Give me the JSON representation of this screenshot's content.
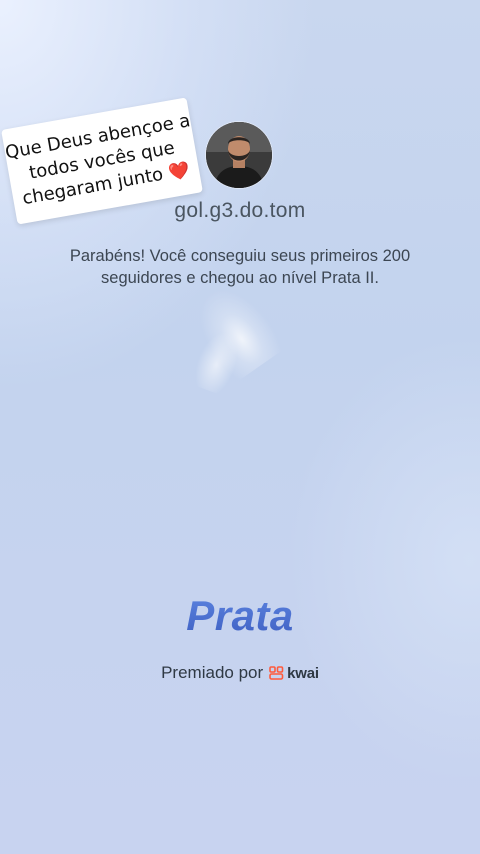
{
  "sticker": {
    "line1": "Que Deus abençoe a",
    "line2": "todos vocês que",
    "line3": "chegaram junto",
    "heart": "❤️"
  },
  "profile": {
    "username": "gol.g3.do.tom",
    "avatar_icon": "user-avatar-photo"
  },
  "message": "Parabéns! Você conseguiu seus primeiros 200 seguidores e chegou ao nível Prata II.",
  "tier": {
    "label": "Prata",
    "color": "#4a6fd0"
  },
  "footer": {
    "awarded_by": "Premiado por",
    "brand": "kwai",
    "brand_icon": "kwai-logo-icon",
    "brand_color": "#ff5a3c"
  }
}
